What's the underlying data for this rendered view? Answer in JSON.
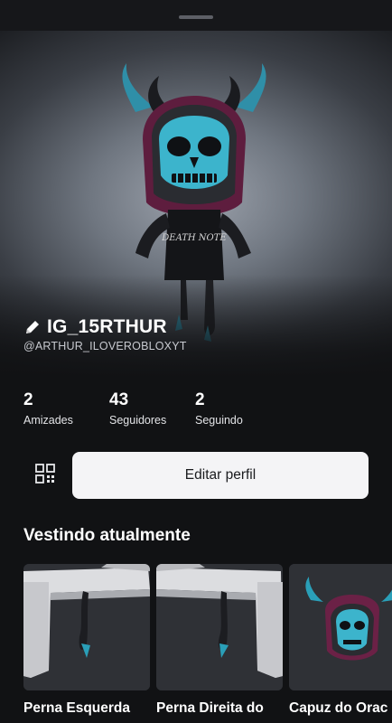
{
  "profile": {
    "display_name": "IG_15RTHUR",
    "username": "@ARTHUR_ILOVEROBLOXYT",
    "avatar_shirt_text": "DEATH NOTE",
    "stats": [
      {
        "count": "2",
        "label": "Amizades"
      },
      {
        "count": "43",
        "label": "Seguidores"
      },
      {
        "count": "2",
        "label": "Seguindo"
      }
    ]
  },
  "actions": {
    "edit_profile_label": "Editar perfil",
    "qr_icon": "qr-code-icon"
  },
  "wearing": {
    "title": "Vestindo atualmente",
    "items": [
      {
        "name": "Perna Esquerda"
      },
      {
        "name": "Perna Direita do"
      },
      {
        "name": "Capuz do Orac"
      }
    ]
  },
  "colors": {
    "background": "#111214",
    "button_bg": "#f4f4f6",
    "accent_teal": "#2a9fb8",
    "hood_purple": "#6b2146"
  }
}
